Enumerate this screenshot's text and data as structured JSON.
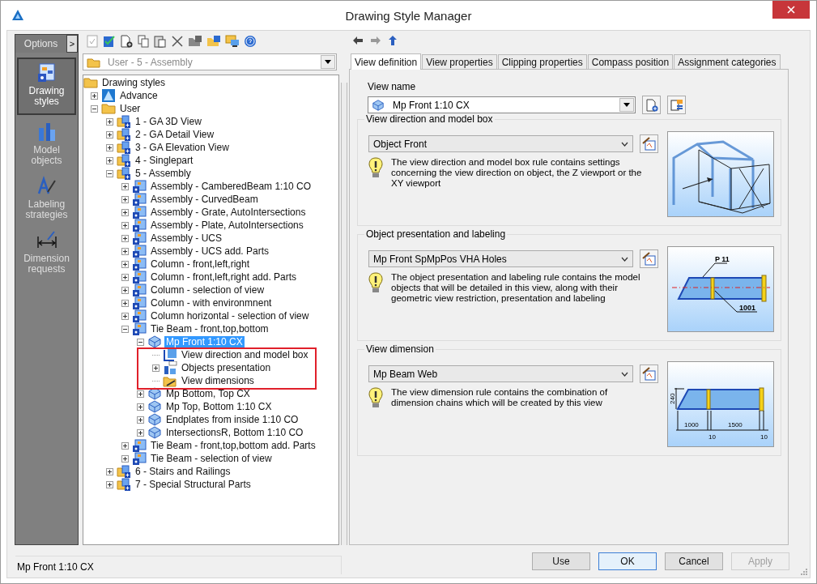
{
  "window": {
    "title": "Drawing Style Manager"
  },
  "sidebar": {
    "header": "Options",
    "expand_button": ">",
    "items": [
      {
        "label": "Drawing styles",
        "kind": "styles",
        "selected": true
      },
      {
        "label": "Model objects",
        "kind": "objects",
        "selected": false
      },
      {
        "label": "Labeling strategies",
        "kind": "labeling",
        "selected": false
      },
      {
        "label": "Dimension requests",
        "kind": "dimension",
        "selected": false
      }
    ]
  },
  "style_selector": {
    "value": "User - 5 - Assembly",
    "disabled": true
  },
  "tree": [
    {
      "label": "Drawing styles",
      "kind": "folder",
      "selected": false,
      "children": [
        {
          "label": "Advance",
          "kind": "logo",
          "expanded": false,
          "selected": false
        },
        {
          "label": "User",
          "kind": "folder",
          "expanded": true,
          "selected": false,
          "children": [
            {
              "label": "1 - GA 3D View",
              "kind": "group",
              "expanded": false,
              "selected": false
            },
            {
              "label": "2 - GA Detail View",
              "kind": "group",
              "expanded": false,
              "selected": false
            },
            {
              "label": "3 - GA Elevation View",
              "kind": "group",
              "expanded": false,
              "selected": false
            },
            {
              "label": "4 - Singlepart",
              "kind": "group",
              "expanded": false,
              "selected": false
            },
            {
              "label": "5 - Assembly",
              "kind": "group",
              "expanded": true,
              "selected": false,
              "children": [
                {
                  "label": "Assembly - CamberedBeam 1:10 CO",
                  "kind": "style",
                  "expanded": false,
                  "selected": false
                },
                {
                  "label": "Assembly - CurvedBeam",
                  "kind": "style",
                  "expanded": false,
                  "selected": false
                },
                {
                  "label": "Assembly - Grate, AutoIntersections",
                  "kind": "style",
                  "expanded": false,
                  "selected": false
                },
                {
                  "label": "Assembly - Plate, AutoIntersections",
                  "kind": "style",
                  "expanded": false,
                  "selected": false
                },
                {
                  "label": "Assembly - UCS",
                  "kind": "style",
                  "expanded": false,
                  "selected": false
                },
                {
                  "label": "Assembly - UCS add. Parts",
                  "kind": "style",
                  "expanded": false,
                  "selected": false
                },
                {
                  "label": "Column - front,left,right",
                  "kind": "style",
                  "expanded": false,
                  "selected": false
                },
                {
                  "label": "Column - front,left,right add. Parts",
                  "kind": "style",
                  "expanded": false,
                  "selected": false
                },
                {
                  "label": "Column - selection of view",
                  "kind": "style",
                  "expanded": false,
                  "selected": false
                },
                {
                  "label": "Column - with environmnent",
                  "kind": "style",
                  "expanded": false,
                  "selected": false
                },
                {
                  "label": "Column horizontal - selection of view",
                  "kind": "style",
                  "expanded": false,
                  "selected": false
                },
                {
                  "label": "Tie Beam - front,top,bottom",
                  "kind": "style",
                  "expanded": true,
                  "selected": false,
                  "children": [
                    {
                      "label": "Mp Front 1:10 CX",
                      "kind": "view",
                      "expanded": true,
                      "selected": true,
                      "highlight_children": true,
                      "children": [
                        {
                          "label": "View direction and model box",
                          "kind": "direction",
                          "selected": false
                        },
                        {
                          "label": "Objects presentation",
                          "kind": "presentation",
                          "expanded": false,
                          "selected": false
                        },
                        {
                          "label": "View dimensions",
                          "kind": "dimensions",
                          "selected": false
                        }
                      ]
                    },
                    {
                      "label": "Mp Bottom, Top CX",
                      "kind": "view",
                      "expanded": false,
                      "selected": false
                    },
                    {
                      "label": "Mp Top, Bottom 1:10 CX",
                      "kind": "view",
                      "expanded": false,
                      "selected": false
                    },
                    {
                      "label": "Endplates from inside 1:10 CO",
                      "kind": "view",
                      "expanded": false,
                      "selected": false
                    },
                    {
                      "label": "IntersectionsR, Bottom 1:10 CO",
                      "kind": "view",
                      "expanded": false,
                      "selected": false
                    }
                  ]
                },
                {
                  "label": "Tie Beam - front,top,bottom add. Parts",
                  "kind": "style",
                  "expanded": false,
                  "selected": false
                },
                {
                  "label": "Tie Beam - selection of view",
                  "kind": "style",
                  "expanded": false,
                  "selected": false
                }
              ]
            },
            {
              "label": "6 - Stairs and Railings",
              "kind": "group",
              "expanded": false,
              "selected": false
            },
            {
              "label": "7 - Special Structural Parts",
              "kind": "group",
              "expanded": false,
              "selected": false
            }
          ]
        }
      ]
    }
  ],
  "tabs": [
    {
      "label": "View definition",
      "selected": true
    },
    {
      "label": "View properties",
      "selected": false
    },
    {
      "label": "Clipping properties",
      "selected": false
    },
    {
      "label": "Compass position",
      "selected": false
    },
    {
      "label": "Assignment categories",
      "selected": false
    }
  ],
  "view_name": {
    "label": "View name",
    "value": "Mp Front 1:10 CX"
  },
  "sections": [
    {
      "title": "View direction and model box",
      "value": "Object Front",
      "description": "The view direction and model box rule contains settings concerning the view direction on object, the Z viewport or the XY viewport",
      "kind": "frame"
    },
    {
      "title": "Object presentation and labeling",
      "value": "Mp Front SpMpPos VHA Holes",
      "description": "The object presentation and labeling rule contains the model objects that will be detailed in this view, along with their geometric view restriction, presentation and labeling",
      "kind": "beam-labels",
      "figure_labels": [
        "P 11",
        "1001"
      ]
    },
    {
      "title": "View dimension",
      "value": "Mp Beam Web",
      "description": "The view dimension rule contains the combination of dimension chains which will be created by this view",
      "kind": "beam-dimensions",
      "figure_labels": [
        "240",
        "1000",
        "10",
        "1500",
        "10"
      ]
    }
  ],
  "status_bar": {
    "text": "Mp Front 1:10 CX"
  },
  "buttons": [
    {
      "label": "Use",
      "default": false,
      "disabled": false
    },
    {
      "label": "OK",
      "default": true,
      "disabled": false
    },
    {
      "label": "Cancel",
      "default": false,
      "disabled": false
    },
    {
      "label": "Apply",
      "default": false,
      "disabled": true
    }
  ]
}
